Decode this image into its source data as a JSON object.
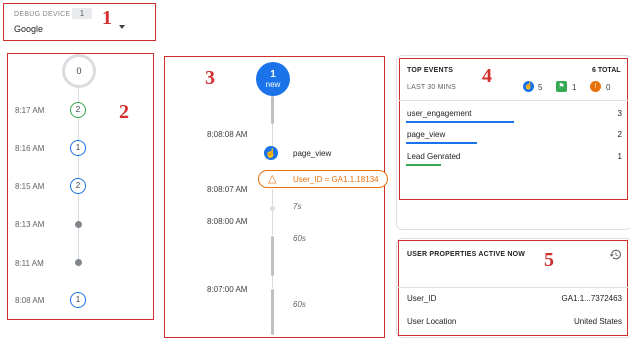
{
  "debug_device": {
    "label": "DEBUG DEVICE",
    "count": "1",
    "selected": "Google"
  },
  "minutes_stream": {
    "top_count": "0",
    "items": [
      {
        "time": "8:17 AM",
        "count": "2",
        "color": "green"
      },
      {
        "time": "8:16 AM",
        "count": "1",
        "color": "blue"
      },
      {
        "time": "8:15 AM",
        "count": "2",
        "color": "blue"
      },
      {
        "time": "8:13 AM",
        "count": "",
        "color": "grey"
      },
      {
        "time": "8:11 AM",
        "count": "",
        "color": "grey"
      },
      {
        "time": "8:08 AM",
        "count": "1",
        "color": "blue"
      }
    ]
  },
  "seconds_stream": {
    "new_count": "1",
    "new_label": "new",
    "times": [
      "8:08:08 AM",
      "8:08:07 AM",
      "8:08:00 AM",
      "8:07:00 AM"
    ],
    "event_label": "page_view",
    "user_property": "User_ID = GA1.1.18134",
    "gaps": [
      "7s",
      "60s",
      "60s"
    ]
  },
  "top_events": {
    "title": "TOP EVENTS",
    "total": "6 TOTAL",
    "subtitle": "LAST 30 MINS",
    "counts": {
      "blue": "5",
      "green": "1",
      "orange": "0"
    },
    "events": [
      {
        "name": "user_engagement",
        "count": "3",
        "share": 0.5,
        "color": "#1a73e8"
      },
      {
        "name": "page_view",
        "count": "2",
        "share": 0.33,
        "color": "#1a73e8"
      },
      {
        "name": "Lead Genrated",
        "count": "1",
        "share": 0.16,
        "color": "#34a853"
      }
    ]
  },
  "user_properties": {
    "title": "USER PROPERTIES ACTIVE NOW",
    "items": [
      {
        "key": "User_ID",
        "value": "GA1.1...7372463"
      },
      {
        "key": "User Location",
        "value": "United States"
      }
    ]
  },
  "annotations": [
    "1",
    "2",
    "3",
    "4",
    "5"
  ],
  "colors": {
    "annotation": "#d32f2f",
    "accent_blue": "#1a73e8",
    "conversion_green": "#34a853",
    "user_prop_orange": "#e8710a"
  },
  "icons": [
    "chevron-down-icon",
    "page-view-icon",
    "user-property-icon",
    "event-count-icon",
    "conversion-icon",
    "error-icon",
    "history-icon"
  ]
}
